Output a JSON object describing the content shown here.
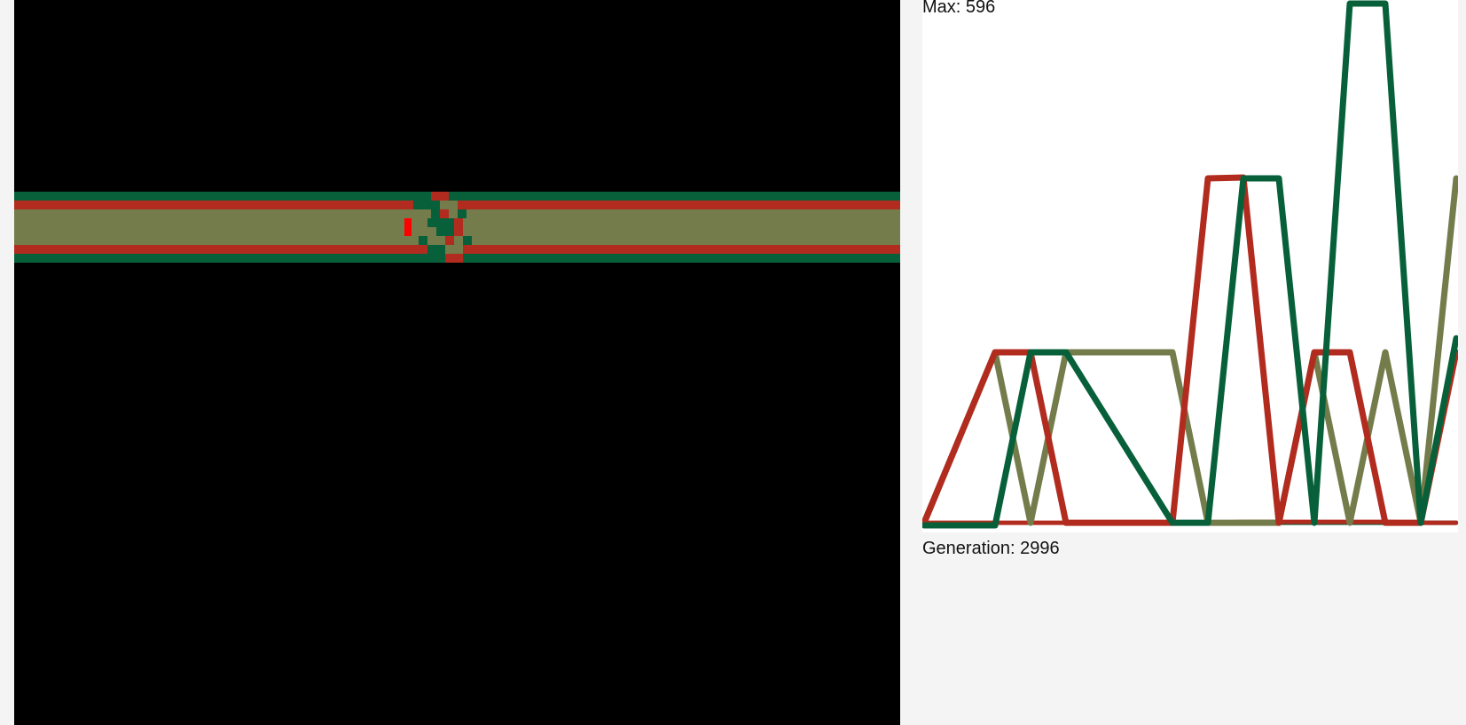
{
  "colors": {
    "background": "#f4f4f4",
    "canvas": "#000000",
    "plot_background": "#ffffff",
    "species_red": "#b22b1f",
    "species_green": "#07603a",
    "species_olive": "#737c4a",
    "highlight_red": "#ff0000"
  },
  "graph": {
    "max_label": "Max: 596",
    "generation_label": "Generation: 2996"
  },
  "chart_data": {
    "type": "line",
    "ylim": [
      0,
      596
    ],
    "x": [
      0,
      4,
      6,
      8,
      14,
      16,
      18,
      20,
      22,
      24,
      26,
      28,
      30
    ],
    "series": [
      {
        "color": "#b22b1f",
        "values": [
          5,
          199,
          199,
          5,
          5,
          397,
          398,
          5,
          199,
          199,
          5,
          5,
          199
        ]
      },
      {
        "color": "#737c4a",
        "values": [
          5,
          199,
          5,
          199,
          199,
          5,
          5,
          5,
          199,
          5,
          199,
          5,
          397
        ]
      },
      {
        "color": "#07603a",
        "values": [
          2,
          2,
          199,
          199,
          5,
          5,
          397,
          397,
          5,
          596,
          596,
          5,
          215
        ]
      },
      {
        "color": "#07603a",
        "values": [
          2,
          3,
          199,
          5,
          5,
          5,
          5,
          5,
          5,
          5,
          5,
          5,
          5
        ]
      },
      {
        "color": "#b22b1f",
        "values": [
          5,
          5,
          5,
          5,
          5,
          5,
          6,
          6,
          6,
          6,
          6,
          5,
          5
        ]
      }
    ]
  }
}
